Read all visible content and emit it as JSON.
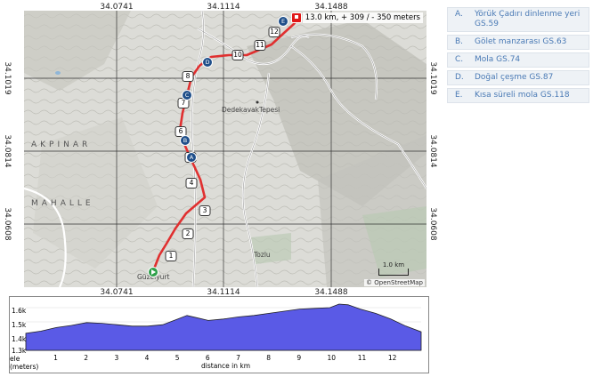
{
  "map": {
    "info": "13.0 km, + 309 / - 350 meters",
    "copyright": "© OpenStreetMap",
    "scale_label": "1.0 km",
    "top_ticks": [
      "34.0741",
      "34.1114",
      "34.1488"
    ],
    "bottom_ticks": [
      "34.0741",
      "34.1114",
      "34.1488"
    ],
    "left_ticks": [
      "34.1019",
      "34.0814",
      "34.0608"
    ],
    "right_ticks": [
      "34.1019",
      "34.0814",
      "34.0608"
    ],
    "places": {
      "akpinar": "AKPINAR",
      "mahalle": "MAHALLE",
      "dedekavak": "DedekavakTepesi",
      "tozlu": "Tozlu",
      "guzelyurt": "Güzelyurt"
    },
    "km_markers": [
      "1",
      "2",
      "3",
      "4",
      "5",
      "6",
      "7",
      "8",
      "10",
      "11",
      "12"
    ],
    "waypoints": [
      "A",
      "B",
      "C",
      "D",
      "E"
    ],
    "route_color": "#e03030"
  },
  "legend": [
    {
      "letter": "A.",
      "text": "Yörük Çadırı dinlenme yeri GS.59"
    },
    {
      "letter": "B.",
      "text": "Gölet manzarası   GS.63"
    },
    {
      "letter": "C.",
      "text": "Mola  GS.74"
    },
    {
      "letter": "D.",
      "text": "Doğal çeşme  GS.87"
    },
    {
      "letter": "E.",
      "text": "Kısa süreli mola  GS.118"
    }
  ],
  "elevation": {
    "y_ticks": [
      "1.6k",
      "1.5k",
      "1.4k",
      "1.3k"
    ],
    "x_ticks": [
      "1",
      "2",
      "3",
      "4",
      "5",
      "6",
      "7",
      "8",
      "9",
      "10",
      "11",
      "12"
    ],
    "y_label": "ele (meters)",
    "x_label": "distance in km",
    "fill_color": "#5a5ae6",
    "chart_data": {
      "type": "area",
      "x": [
        0,
        0.5,
        1,
        1.5,
        2,
        2.5,
        3,
        3.5,
        4,
        4.5,
        5,
        5.3,
        5.6,
        6,
        6.5,
        7,
        7.5,
        8,
        8.5,
        9,
        9.5,
        10,
        10.3,
        10.6,
        11,
        11.5,
        12,
        12.5,
        13
      ],
      "y": [
        1420,
        1435,
        1460,
        1475,
        1495,
        1490,
        1480,
        1470,
        1470,
        1480,
        1520,
        1545,
        1530,
        1510,
        1520,
        1535,
        1545,
        1560,
        1575,
        1590,
        1595,
        1600,
        1625,
        1620,
        1590,
        1560,
        1520,
        1470,
        1430
      ]
    }
  }
}
